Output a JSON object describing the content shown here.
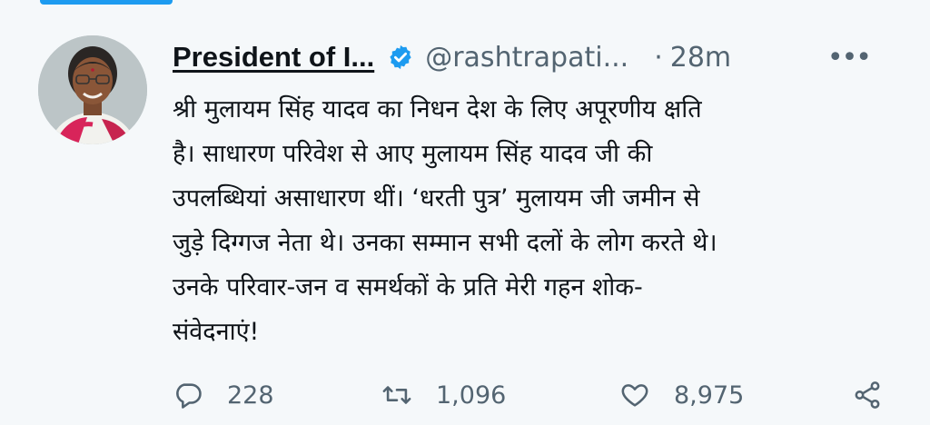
{
  "tweet": {
    "author_name": "President of I...",
    "handle": "@rashtrapati...",
    "separator": "·",
    "time": "28m",
    "more_label": "•••",
    "text_lines": [
      "श्री मुलायम सिंह यादव का निधन देश के लिए अपूरणीय क्षति",
      "है। साधारण परिवेश से आए मुलायम सिंह यादव जी की",
      "उपलब्धियां असाधारण थीं। ‘धरती पुत्र’ मुलायम जी जमीन से",
      "जुड़े दिग्गज नेता थे। उनका सम्मान सभी दलों के लोग करते थे।",
      "उनके परिवार-जन व समर्थकों के प्रति मेरी गहन शोक-",
      "संवेदनाएं!"
    ]
  },
  "actions": {
    "replies": "228",
    "retweets": "1,096",
    "likes": "8,975"
  },
  "icons": {
    "verified": "verified-badge-icon",
    "reply": "reply-icon",
    "retweet": "retweet-icon",
    "like": "heart-icon",
    "share": "share-icon",
    "more": "more-icon"
  },
  "colors": {
    "accent": "#1d9bf0",
    "muted_text": "#536471",
    "background": "#f5f8fa"
  }
}
